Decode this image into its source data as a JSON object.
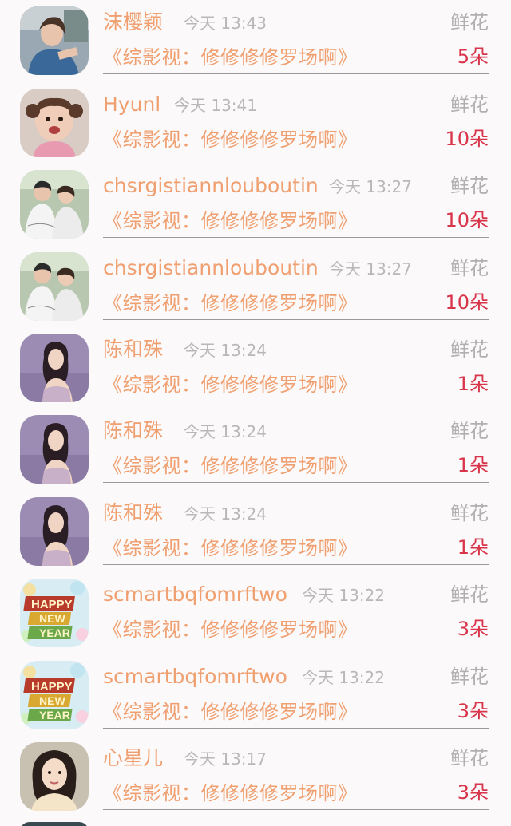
{
  "gift_label": "鲜花",
  "rows": [
    {
      "name": "沫樱颖",
      "time": "今天 13:43",
      "message": "《综影视：修修修修罗场啊》",
      "count": "5朵",
      "avatar_icon": "avatar-girl-blue-photo"
    },
    {
      "name": "Hyunl",
      "time": "今天 13:41",
      "message": "《综影视：修修修修罗场啊》",
      "count": "10朵",
      "avatar_icon": "avatar-baby-photo"
    },
    {
      "name": "chsrgistiannlouboutin",
      "time": "今天 13:27",
      "message": "《综影视：修修修修罗场啊》",
      "count": "10朵",
      "avatar_icon": "avatar-couple-photo"
    },
    {
      "name": "chsrgistiannlouboutin",
      "time": "今天 13:27",
      "message": "《综影视：修修修修罗场啊》",
      "count": "10朵",
      "avatar_icon": "avatar-couple-photo"
    },
    {
      "name": "陈和殊",
      "time": "今天 13:24",
      "message": "《综影视：修修修修罗场啊》",
      "count": "1朵",
      "avatar_icon": "avatar-woman-purple-photo"
    },
    {
      "name": "陈和殊",
      "time": "今天 13:24",
      "message": "《综影视：修修修修罗场啊》",
      "count": "1朵",
      "avatar_icon": "avatar-woman-purple-photo"
    },
    {
      "name": "陈和殊",
      "time": "今天 13:24",
      "message": "《综影视：修修修修罗场啊》",
      "count": "1朵",
      "avatar_icon": "avatar-woman-purple-photo"
    },
    {
      "name": "scmartbqfomrftwo",
      "time": "今天 13:22",
      "message": "《综影视：修修修修罗场啊》",
      "count": "3朵",
      "avatar_icon": "avatar-happy-new-year"
    },
    {
      "name": "scmartbqfomrftwo",
      "time": "今天 13:22",
      "message": "《综影视：修修修修罗场啊》",
      "count": "3朵",
      "avatar_icon": "avatar-happy-new-year"
    },
    {
      "name": "心星儿",
      "time": "今天 13:17",
      "message": "《综影视：修修修修罗场啊》",
      "count": "3朵",
      "avatar_icon": "avatar-woman-portrait-photo"
    }
  ],
  "hny": {
    "line1": "HAPPY",
    "line2": "NEW",
    "line3": "YEAR"
  }
}
